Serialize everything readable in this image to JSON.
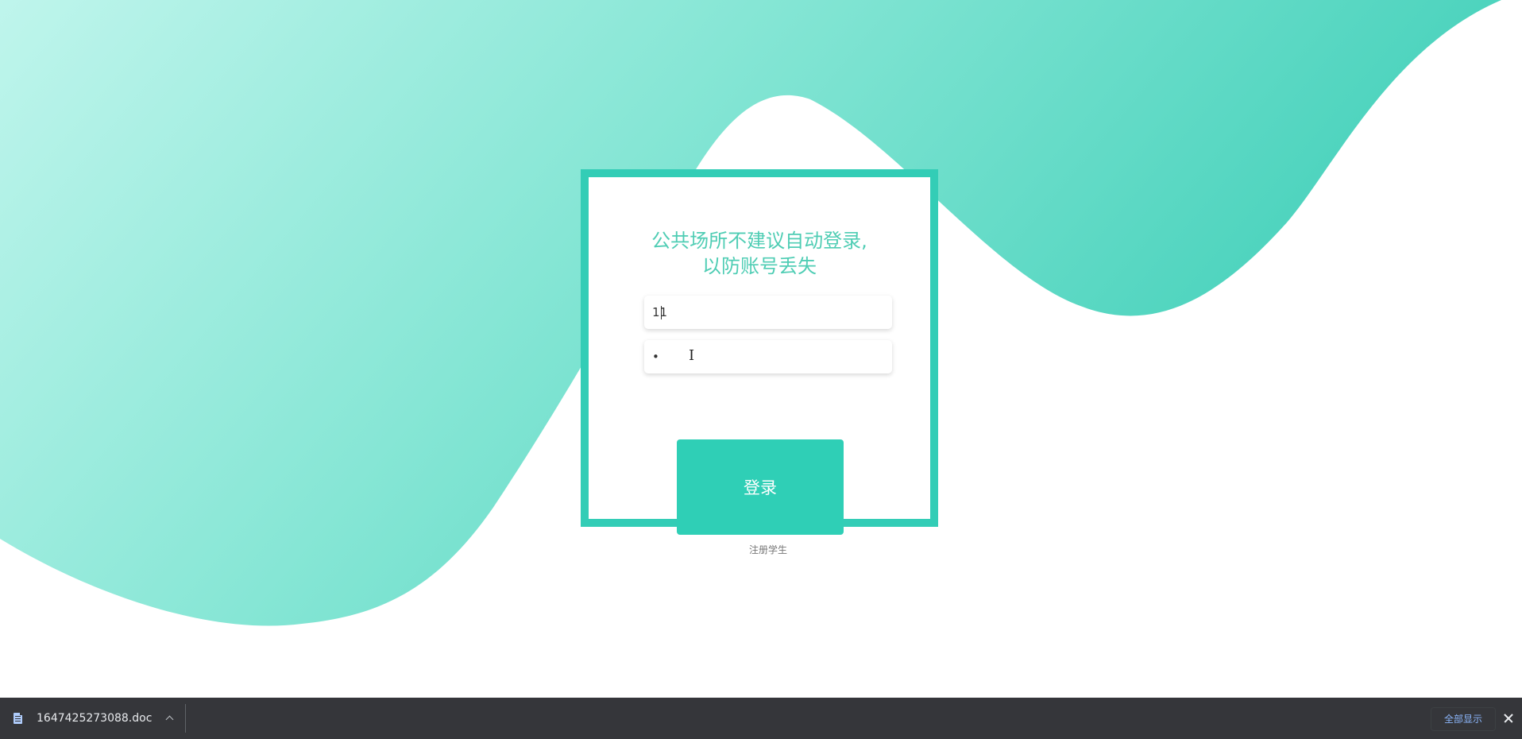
{
  "colors": {
    "accent": "#33cdb6",
    "wave_light": "#bff5ec",
    "wave_dark": "#3fcfb8",
    "title_text": "#4fcdb4",
    "download_bar": "#35363a",
    "link_blue": "#8ab4f8"
  },
  "login": {
    "title_line1": "公共场所不建议自动登录,",
    "title_line2": "以防账号丢失",
    "username_value": "11",
    "password_value": "•",
    "submit_label": "登录",
    "register_label": "注册学生"
  },
  "download_bar": {
    "filename": "1647425273088.doc",
    "file_icon": "doc-file-icon",
    "expand_icon": "chevron-up-icon",
    "show_all_label": "全部显示",
    "close_icon": "close-icon"
  }
}
